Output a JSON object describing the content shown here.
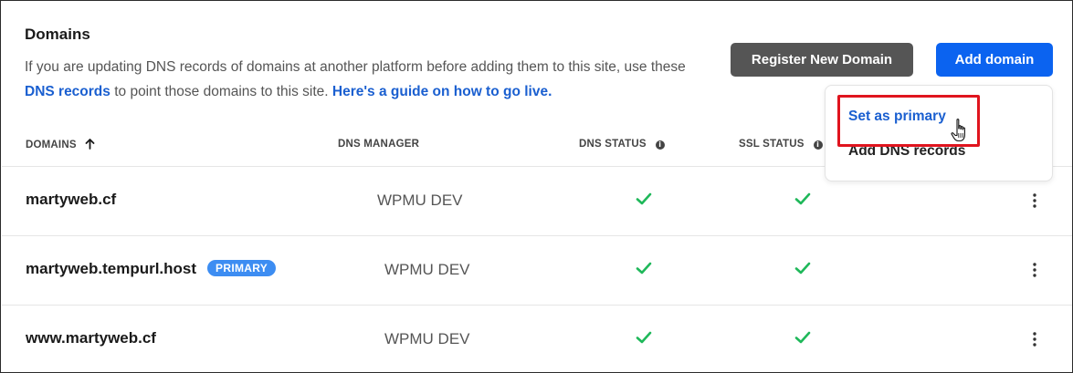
{
  "header": {
    "title": "Domains",
    "desc_part1": "If you are updating DNS records of domains at another platform before adding them to this site, use these ",
    "dns_link": "DNS records",
    "desc_part2": " to point those domains to this site. ",
    "guide_link": "Here's a guide on how to go live.",
    "register_button": "Register New Domain",
    "add_button": "Add domain"
  },
  "table": {
    "columns": {
      "domains": "DOMAINS",
      "dns_manager": "DNS MANAGER",
      "dns_status": "DNS STATUS",
      "ssl_status": "SSL STATUS"
    },
    "rows": [
      {
        "domain": "martyweb.cf",
        "badge": "",
        "manager": "WPMU DEV",
        "dns_ok": true,
        "ssl_ok": true
      },
      {
        "domain": "martyweb.tempurl.host",
        "badge": "PRIMARY",
        "manager": "WPMU DEV",
        "dns_ok": true,
        "ssl_ok": true
      },
      {
        "domain": "www.martyweb.cf",
        "badge": "",
        "manager": "WPMU DEV",
        "dns_ok": true,
        "ssl_ok": true
      }
    ]
  },
  "dropdown": {
    "set_primary": "Set as primary",
    "add_dns": "Add DNS records"
  },
  "icons": {
    "sort": "arrow-up-icon",
    "info": "info-icon",
    "check": "check-icon",
    "kebab": "kebab-menu-icon",
    "cursor": "hand-pointer-cursor"
  },
  "colors": {
    "accent": "#0b63f0",
    "link": "#1a5fd0",
    "register_button_bg": "#555555",
    "badge_bg": "#3d8df2",
    "check_green": "#1fb85a",
    "highlight_red": "#e0141e"
  }
}
